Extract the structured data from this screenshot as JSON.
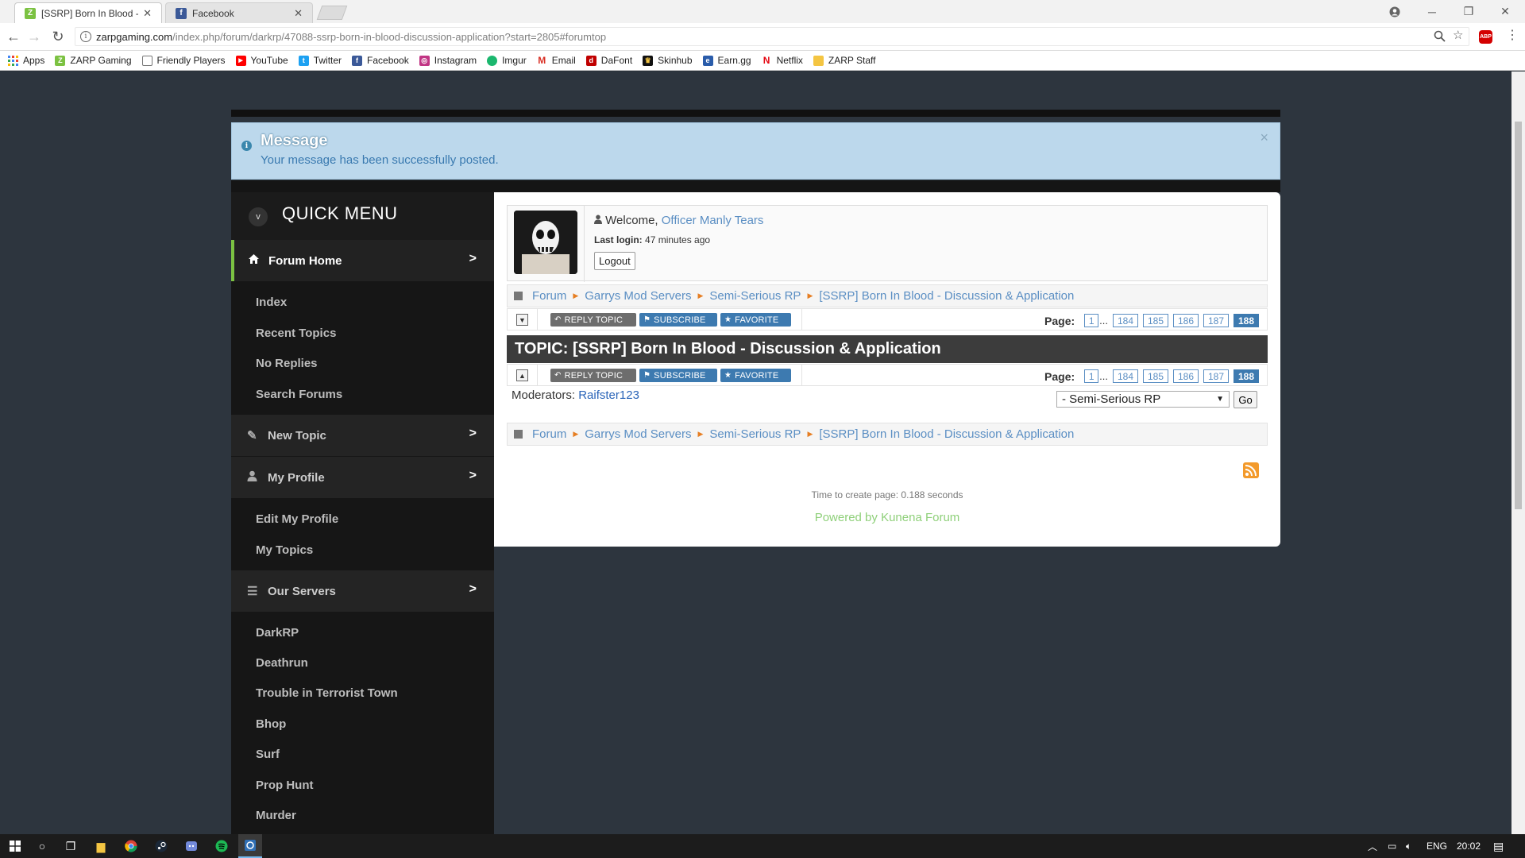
{
  "browser": {
    "tabs": [
      {
        "title": "[SSRP] Born In Blood - D",
        "active": true,
        "icon": "zarp-icon"
      },
      {
        "title": "Facebook",
        "active": false,
        "icon": "facebook-icon"
      }
    ],
    "url_host": "zarpgaming.com",
    "url_path": "/index.php/forum/darkrp/47088-ssrp-born-in-blood-discussion-application?start=2805#forumtop",
    "bookmarks": [
      {
        "label": "Apps",
        "icon": "apps-grid-icon",
        "color": "#4285f4"
      },
      {
        "label": "ZARP Gaming",
        "icon": "zarp-icon",
        "color": "#7cc242"
      },
      {
        "label": "Friendly Players",
        "icon": "page-icon",
        "color": "#777777"
      },
      {
        "label": "YouTube",
        "icon": "youtube-icon",
        "color": "#ff0000"
      },
      {
        "label": "Twitter",
        "icon": "twitter-icon",
        "color": "#1da1f2"
      },
      {
        "label": "Facebook",
        "icon": "facebook-icon",
        "color": "#3b5998"
      },
      {
        "label": "Instagram",
        "icon": "instagram-icon",
        "color": "#c13584"
      },
      {
        "label": "Imgur",
        "icon": "imgur-icon",
        "color": "#1bb76e"
      },
      {
        "label": "Email",
        "icon": "gmail-icon",
        "color": "#d93025"
      },
      {
        "label": "DaFont",
        "icon": "dafont-icon",
        "color": "#c00000"
      },
      {
        "label": "Skinhub",
        "icon": "skinhub-icon",
        "color": "#111111"
      },
      {
        "label": "Earn.gg",
        "icon": "earngg-icon",
        "color": "#2a5caa"
      },
      {
        "label": "Netflix",
        "icon": "netflix-icon",
        "color": "#e50914"
      },
      {
        "label": "ZARP Staff",
        "icon": "folder-icon",
        "color": "#f4c542"
      }
    ]
  },
  "message": {
    "title": "Message",
    "text": "Your message has been successfully posted.",
    "close": "×"
  },
  "sidebar": {
    "title": "QUICK MENU",
    "toggle": "v",
    "sections": [
      {
        "label": "Forum Home",
        "icon": "home-icon",
        "active": true,
        "arrow": ">",
        "items": [
          "Index",
          "Recent Topics",
          "No Replies",
          "Search Forums"
        ]
      },
      {
        "label": "New Topic",
        "icon": "pencil-icon",
        "active": false,
        "arrow": ">",
        "items": []
      },
      {
        "label": "My Profile",
        "icon": "user-icon",
        "active": false,
        "arrow": ">",
        "items": [
          "Edit My Profile",
          "My Topics"
        ]
      },
      {
        "label": "Our Servers",
        "icon": "menu-icon",
        "active": false,
        "arrow": ">",
        "items": [
          "DarkRP",
          "Deathrun",
          "Trouble in Terrorist Town",
          "Bhop",
          "Surf",
          "Prop Hunt",
          "Murder"
        ]
      }
    ]
  },
  "welcome": {
    "prefix": "Welcome, ",
    "username": "Officer Manly Tears",
    "last_login_label": "Last login:",
    "last_login_value": "47 minutes ago",
    "logout": "Logout"
  },
  "breadcrumb": [
    "Forum",
    "Garrys Mod Servers",
    "Semi-Serious RP",
    "[SSRP] Born In Blood - Discussion & Application"
  ],
  "actions": {
    "reply": "REPLY TOPIC",
    "subscribe": "SUBSCRIBE",
    "favorite": "FAVORITE"
  },
  "pagination": {
    "label": "Page:",
    "first": "1",
    "dots": "...",
    "pages": [
      "184",
      "185",
      "186",
      "187"
    ],
    "current": "188"
  },
  "topic": {
    "title": "TOPIC: [SSRP] Born In Blood - Discussion & Application"
  },
  "moderators": {
    "label": "Moderators: ",
    "name": "Raifster123"
  },
  "jump": {
    "selected": "- Semi-Serious RP",
    "go": "Go"
  },
  "footer": {
    "time": "Time to create page: 0.188 seconds",
    "powered": "Powered by Kunena Forum"
  },
  "taskbar": {
    "language": "ENG",
    "time": "20:02"
  }
}
